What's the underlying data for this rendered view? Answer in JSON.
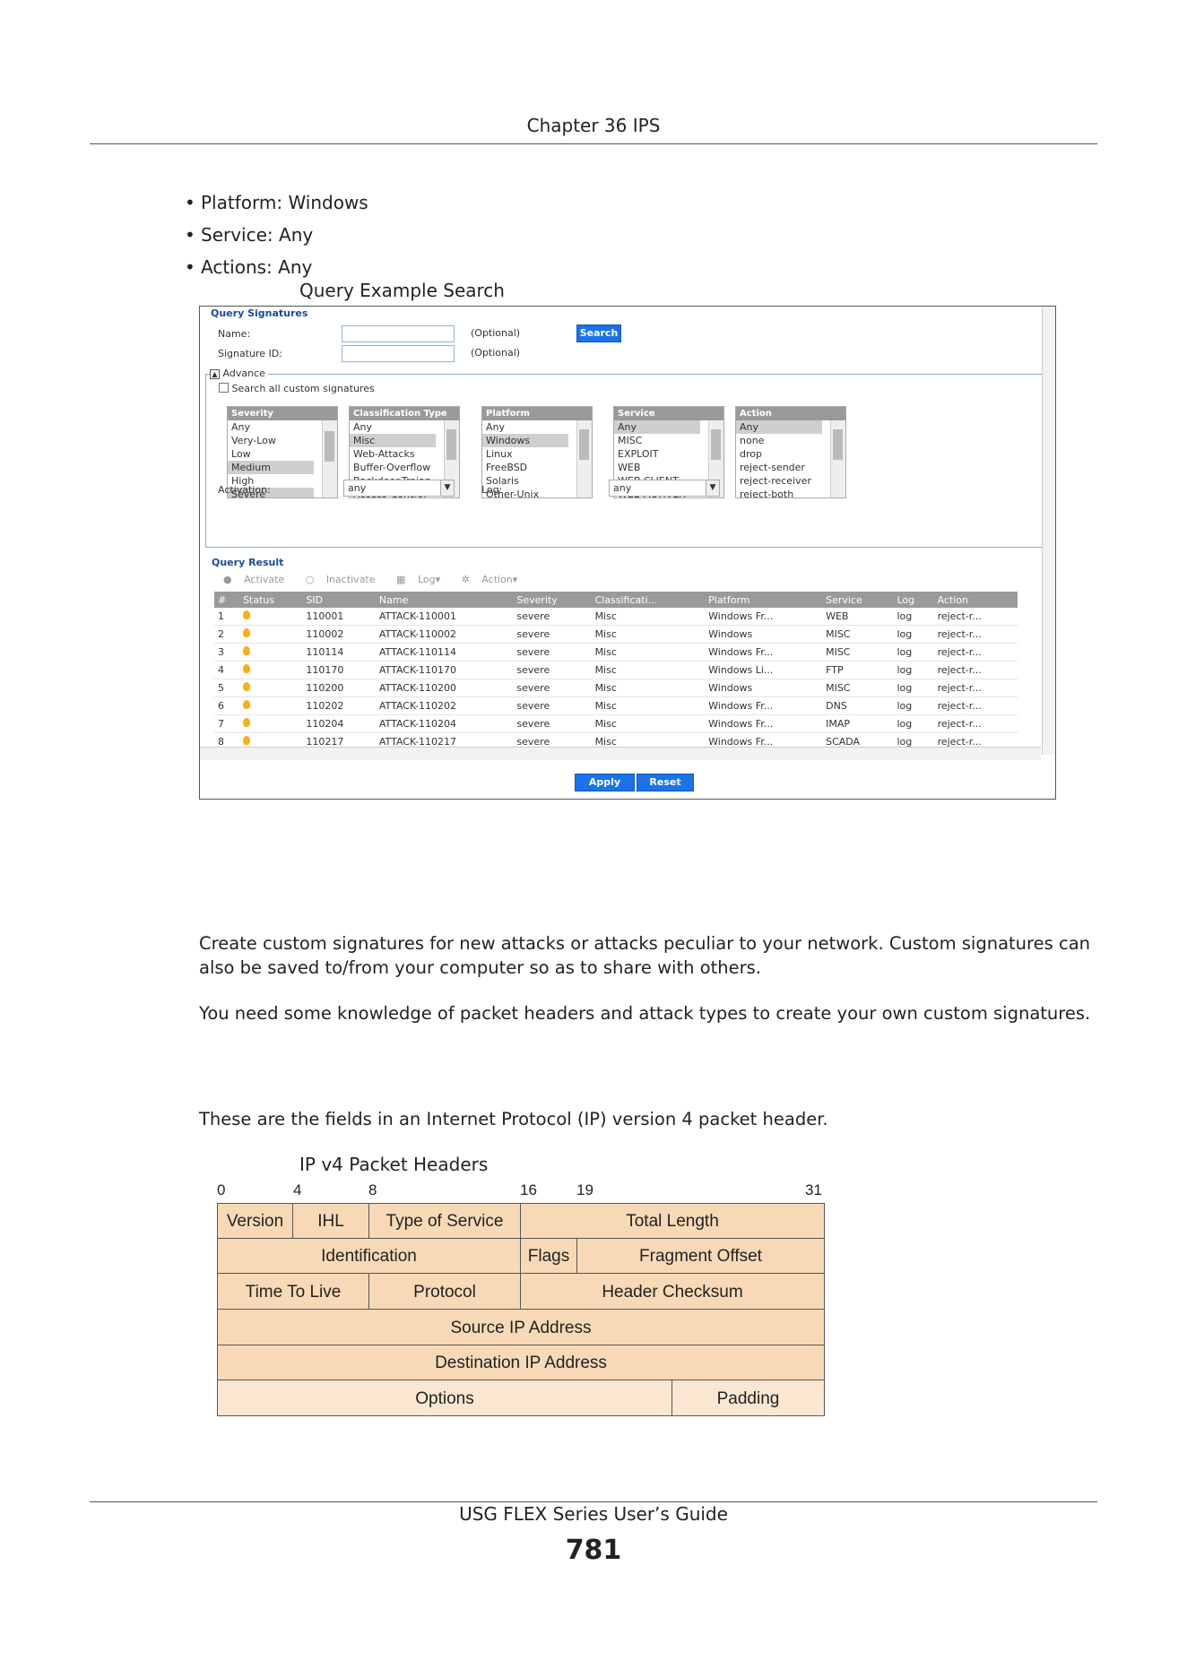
{
  "header": {
    "title": "Chapter 36 IPS"
  },
  "bullets": [
    "Platform: Windows",
    "Service: Any",
    "Actions: Any"
  ],
  "figure1_caption": "Query Example Search",
  "ui": {
    "query_signatures": "Query Signatures",
    "name_label": "Name:",
    "sigid_label": "Signature ID:",
    "optional1": "(Optional)",
    "optional2": "(Optional)",
    "search_btn": "Search",
    "advance": "Advance",
    "search_all": "Search all custom signatures",
    "lists": [
      {
        "header": "Severity",
        "items": [
          "Any",
          "Very-Low",
          "Low",
          "Medium",
          "High",
          "Severe"
        ],
        "selected": [
          3,
          5
        ]
      },
      {
        "header": "Classification Type",
        "items": [
          "Any",
          "Misc",
          "Web-Attacks",
          "Buffer-Overflow",
          "Backdoor-Trojan",
          "Access-Control"
        ],
        "selected": [
          1
        ]
      },
      {
        "header": "Platform",
        "items": [
          "Any",
          "Windows",
          "Linux",
          "FreeBSD",
          "Solaris",
          "Other-Unix"
        ],
        "selected": [
          1
        ]
      },
      {
        "header": "Service",
        "items": [
          "Any",
          "MISC",
          "EXPLOIT",
          "WEB",
          "WEB CLIENT",
          "WEB ACTIVEX"
        ],
        "selected": [
          0
        ]
      },
      {
        "header": "Action",
        "items": [
          "Any",
          "none",
          "drop",
          "reject-sender",
          "reject-receiver",
          "reject-both"
        ],
        "selected": [
          0
        ]
      }
    ],
    "activation_label": "Activation:",
    "activation_value": "any",
    "log_label": "Log:",
    "log_value": "any",
    "query_result": "Query Result",
    "toolbar": [
      "Activate",
      "Inactivate",
      "Log▾",
      "Action▾"
    ],
    "columns": [
      "#",
      "Status",
      "SID",
      "Name",
      "Severity",
      "Classificati...",
      "Platform",
      "Service",
      "Log",
      "Action"
    ],
    "rows": [
      [
        "1",
        "110001",
        "ATTACK-110001",
        "severe",
        "Misc",
        "Windows Fr...",
        "WEB",
        "log",
        "reject-r..."
      ],
      [
        "2",
        "110002",
        "ATTACK-110002",
        "severe",
        "Misc",
        "Windows",
        "MISC",
        "log",
        "reject-r..."
      ],
      [
        "3",
        "110114",
        "ATTACK-110114",
        "severe",
        "Misc",
        "Windows Fr...",
        "MISC",
        "log",
        "reject-r..."
      ],
      [
        "4",
        "110170",
        "ATTACK-110170",
        "severe",
        "Misc",
        "Windows Li...",
        "FTP",
        "log",
        "reject-r..."
      ],
      [
        "5",
        "110200",
        "ATTACK-110200",
        "severe",
        "Misc",
        "Windows",
        "MISC",
        "log",
        "reject-r..."
      ],
      [
        "6",
        "110202",
        "ATTACK-110202",
        "severe",
        "Misc",
        "Windows Fr...",
        "DNS",
        "log",
        "reject-r..."
      ],
      [
        "7",
        "110204",
        "ATTACK-110204",
        "severe",
        "Misc",
        "Windows Fr...",
        "IMAP",
        "log",
        "reject-r..."
      ],
      [
        "8",
        "110217",
        "ATTACK-110217",
        "severe",
        "Misc",
        "Windows Fr...",
        "SCADA",
        "log",
        "reject-r..."
      ]
    ],
    "apply_btn": "Apply",
    "reset_btn": "Reset"
  },
  "para1": "Create custom signatures for new attacks or attacks peculiar to your network. Custom signatures can also be saved to/from your computer so as to share with others.",
  "para2": "You need some knowledge of packet headers and attack types to create your own custom signatures.",
  "para3": "These are the fields in an Internet Protocol (IP) version 4 packet header.",
  "figure2_caption": "IP v4 Packet Headers",
  "ip_header": {
    "bits": [
      "0",
      "4",
      "8",
      "16",
      "19",
      "31"
    ],
    "fields": [
      "Version",
      "IHL",
      "Type of Service",
      "Total Length",
      "Identification",
      "Flags",
      "Fragment Offset",
      "Time To Live",
      "Protocol",
      "Header Checksum",
      "Source IP Address",
      "Destination IP Address",
      "Options",
      "Padding"
    ]
  },
  "footer": {
    "guide": "USG FLEX Series User’s Guide",
    "page": "781"
  }
}
